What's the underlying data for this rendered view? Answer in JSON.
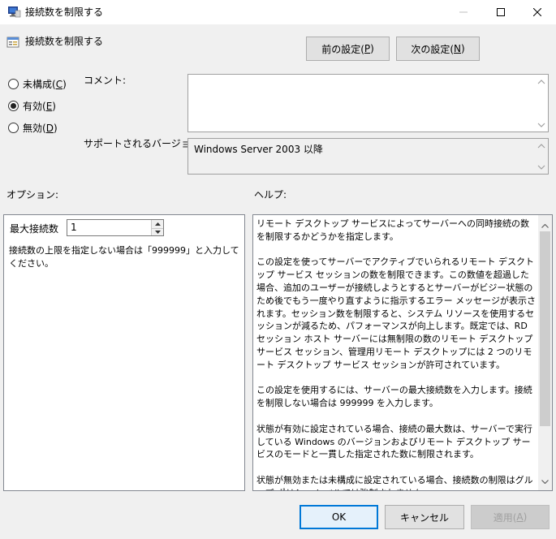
{
  "window": {
    "title": "接続数を制限する"
  },
  "header": {
    "policy_name": "接続数を制限する",
    "prev_label_prefix": "前の設定(",
    "prev_key": "P",
    "prev_label_suffix": ")",
    "next_label_prefix": "次の設定(",
    "next_key": "N",
    "next_label_suffix": ")"
  },
  "state": {
    "options": [
      {
        "prefix": "未構成(",
        "key": "C",
        "suffix": ")",
        "checked": false
      },
      {
        "prefix": "有効(",
        "key": "E",
        "suffix": ")",
        "checked": true
      },
      {
        "prefix": "無効(",
        "key": "D",
        "suffix": ")",
        "checked": false
      }
    ]
  },
  "comment": {
    "label": "コメント:",
    "value": ""
  },
  "supported": {
    "label": "サポートされるバージョン:",
    "value": "Windows Server 2003 以降"
  },
  "options_panel": {
    "heading": "オプション:",
    "max_connections_label": "最大接続数",
    "max_connections_value": "1",
    "hint": "接続数の上限を指定しない場合は「999999」と入力してください。"
  },
  "help_panel": {
    "heading": "ヘルプ:",
    "text": "リモート デスクトップ サービスによってサーバーへの同時接続の数を制限するかどうかを指定します。\n\nこの設定を使ってサーバーでアクティブでいられるリモート デスクトップ サービス セッションの数を制限できます。この数値を超過した場合、追加のユーザーが接続しようとするとサーバーがビジー状態のため後でもう一度やり直すように指示するエラー メッセージが表示されます。セッション数を制限すると、システム リソースを使用するセッションが減るため、パフォーマンスが向上します。既定では、RD セッション ホスト サーバーには無制限の数のリモート デスクトップ サービス セッション、管理用リモート デスクトップには 2 つのリモート デスクトップ サービス セッションが許可されています。\n\nこの設定を使用するには、サーバーの最大接続数を入力します。接続を制限しない場合は 999999 を入力します。\n\n状態が有効に設定されている場合、接続の最大数は、サーバーで実行している Windows のバージョンおよびリモート デスクトップ サービスのモードと一貫した指定された数に制限されます。\n\n状態が無効または未構成に設定されている場合、接続数の制限はグループ ポリシー レベルでは強制されません。\n\n注: この設定は RD セッション ホスト サーバー (リモート デスクトップ サー"
  },
  "footer": {
    "ok_label": "OK",
    "cancel_label": "キャンセル",
    "apply_prefix": "適用(",
    "apply_key": "A",
    "apply_suffix": ")"
  },
  "colors": {
    "accent": "#0078d7",
    "window_bg": "#f0f0f0"
  }
}
